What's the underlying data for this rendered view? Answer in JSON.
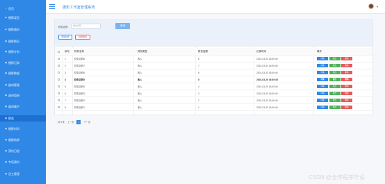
{
  "app": {
    "title": "摄影工作室管理系统"
  },
  "sidebar": {
    "items": [
      {
        "label": "首页",
        "icon": "home-icon",
        "active": false
      },
      {
        "label": "摄影类型",
        "icon": "camera-icon",
        "active": false
      },
      {
        "label": "摄影器材",
        "icon": "equipment-icon",
        "active": false
      },
      {
        "label": "摄影概况",
        "icon": "info-icon",
        "active": false
      },
      {
        "label": "摄影计划",
        "icon": "plan-icon",
        "active": false
      },
      {
        "label": "摄影记录",
        "icon": "record-icon",
        "active": false
      },
      {
        "label": "摄影数据",
        "icon": "data-icon",
        "active": false
      },
      {
        "label": "器材管理",
        "icon": "manage-icon",
        "active": false
      },
      {
        "label": "器材租借",
        "icon": "borrow-icon",
        "active": false
      },
      {
        "label": "器材维护",
        "icon": "wrench-icon",
        "active": false
      },
      {
        "label": "财务",
        "icon": "money-icon",
        "active": true
      },
      {
        "label": "摄影时间",
        "icon": "clock-icon",
        "active": false
      },
      {
        "label": "摄影结果",
        "icon": "result-icon",
        "active": false
      },
      {
        "label": "预约日程",
        "icon": "calendar-icon",
        "active": false
      },
      {
        "label": "专项预约",
        "icon": "star-icon",
        "active": false
      },
      {
        "label": "员工管理",
        "icon": "user-icon",
        "active": false
      }
    ]
  },
  "search": {
    "label": "财务名称",
    "placeholder": "财务名称",
    "button": "查询"
  },
  "toolbar": {
    "add_label": "添加财务",
    "delete_label": "批量删除"
  },
  "table": {
    "columns": [
      "",
      "序号",
      "财务名称",
      "财务类型",
      "财务金额",
      "记录时间",
      "操作"
    ],
    "rows": [
      {
        "index": "1",
        "name": "财务名称8",
        "type": "收入",
        "amount": "6",
        "time": "2024-03-20 16:49:40",
        "bold": false
      },
      {
        "index": "2",
        "name": "财务名称7",
        "type": "收入",
        "amount": "7",
        "time": "2024-03-20 16:49:40",
        "bold": false
      },
      {
        "index": "3",
        "name": "财务名称6",
        "type": "收入",
        "amount": "6",
        "time": "2024-03-20 16:49:40",
        "bold": false
      },
      {
        "index": "4",
        "name": "财务名称5",
        "type": "收入",
        "amount": "5",
        "time": "2024-03-20 16:49:40",
        "bold": true
      },
      {
        "index": "5",
        "name": "财务名称4",
        "type": "收入",
        "amount": "4",
        "time": "2024-03-20 16:49:40",
        "bold": false
      },
      {
        "index": "6",
        "name": "财务名称3",
        "type": "收入",
        "amount": "3",
        "time": "2024-03-20 16:49:40",
        "bold": false
      },
      {
        "index": "7",
        "name": "财务名称2",
        "type": "收入",
        "amount": "2",
        "time": "2024-03-20 16:49:40",
        "bold": false
      },
      {
        "index": "8",
        "name": "财务名称1",
        "type": "收入",
        "amount": "1",
        "time": "2024-03-20 16:49:40",
        "bold": false
      }
    ],
    "actions": {
      "detail": "详情",
      "edit": "修改",
      "delete": "删除"
    }
  },
  "pagination": {
    "total": "共 8 条",
    "prev": "上一页",
    "current": "1",
    "next": "下一页"
  },
  "watermark": "CSDN @全传程序毕设",
  "colors": {
    "primary": "#2f88e6",
    "edit": "#52b05a",
    "danger": "#e35b5b"
  }
}
